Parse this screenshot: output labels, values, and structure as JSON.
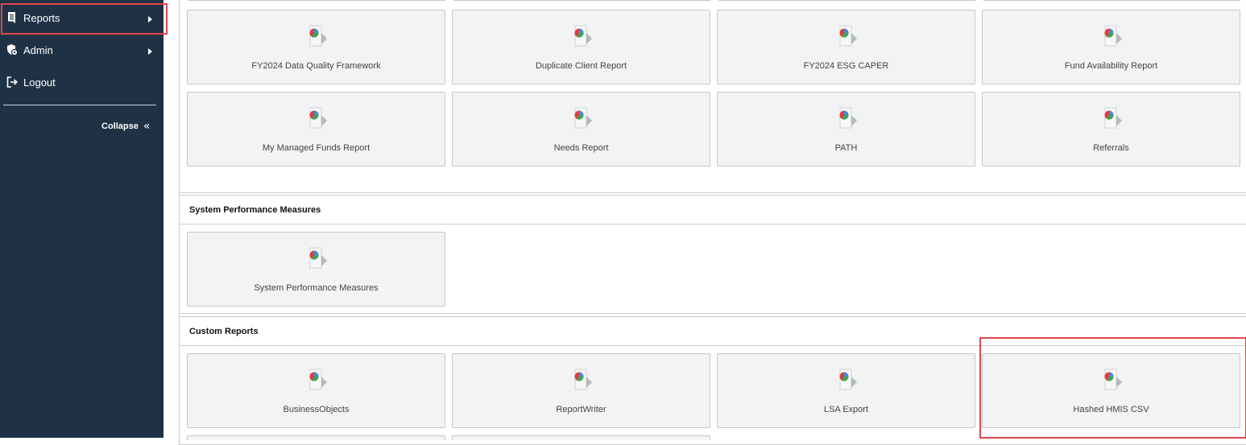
{
  "sidebar": {
    "items": [
      {
        "label": "Reports",
        "icon": "report-icon"
      },
      {
        "label": "Admin",
        "icon": "admin-shield-icon"
      },
      {
        "label": "Logout",
        "icon": "logout-icon"
      }
    ],
    "collapse_label": "Collapse"
  },
  "report_tiles_top": [
    {
      "label": "FY2024 Data Quality Framework"
    },
    {
      "label": "Duplicate Client Report"
    },
    {
      "label": "FY2024 ESG CAPER"
    },
    {
      "label": "Fund Availability Report"
    },
    {
      "label": "My Managed Funds Report"
    },
    {
      "label": "Needs Report"
    },
    {
      "label": "PATH"
    },
    {
      "label": "Referrals"
    }
  ],
  "system_performance": {
    "title": "System Performance Measures",
    "tiles": [
      {
        "label": "System Performance Measures"
      }
    ]
  },
  "custom_reports": {
    "title": "Custom Reports",
    "tiles": [
      {
        "label": "BusinessObjects"
      },
      {
        "label": "ReportWriter"
      },
      {
        "label": "LSA Export"
      },
      {
        "label": "Hashed HMIS CSV"
      }
    ]
  },
  "colors": {
    "sidebar_bg": "#1f3245",
    "highlight": "#e0474c",
    "tile_bg": "#f2f3f4"
  }
}
